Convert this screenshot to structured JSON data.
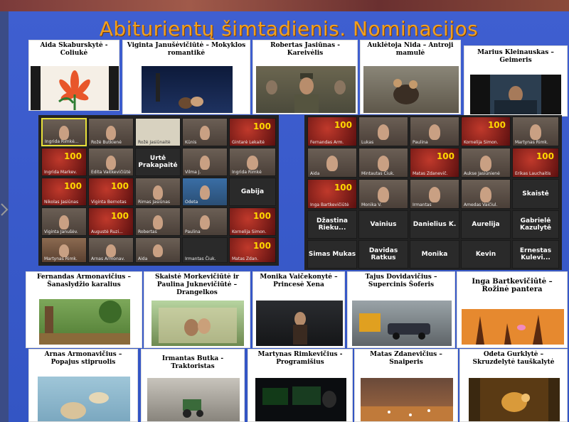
{
  "title": "Abiturientų šimtadienis. Nominacijos",
  "colors": {
    "title": "#f0a020",
    "slide": "#3f5fd0",
    "tile100": "#c0392b"
  },
  "top_cards": [
    {
      "label": "Aida Skaburskytė - Coliukė"
    },
    {
      "label": "Viginta Janušėvičiūtė – Mokyklos romantikė"
    },
    {
      "label": "Robertas Jasiūnas - Kareivėlis"
    },
    {
      "label": "Auklėtoja Nida – Antroji mamulė"
    },
    {
      "label": "Marius Kleinauskas – Geimeris"
    }
  ],
  "mid_cards": [
    {
      "label": "Fernandas Armonavičius – Šanaslydžio karalius"
    },
    {
      "label": "Skaistė Morkevičiūtė ir Paulina Juknevičiūtė – Drangelkos"
    },
    {
      "label": "Monika Vaičekonytė – Princesė Xena"
    },
    {
      "label": "Tajus Dovidavičius – Supercinis Šoferis"
    },
    {
      "label": "Inga Bartkevičiūtė – Rožinė pantera"
    }
  ],
  "bottom_cards": [
    {
      "label": "Arnas Armonavičius – Popajus stipruolis"
    },
    {
      "label": "Irmantas Butka - Traktoristas"
    },
    {
      "label": "Martynas Rimkevičius - Programišius"
    },
    {
      "label": "Matas Zdanevičius – Snaiperis"
    },
    {
      "label": "Odeta Gurklytė – Skruzdelytė tauškalytė"
    }
  ],
  "left_grid": {
    "named_tiles": [
      {
        "label": "Urtė Prakapaitė"
      },
      {
        "label": "Gabija"
      }
    ],
    "badge": "100"
  },
  "right_grid": {
    "named_tiles": [
      {
        "label": "Skaistė"
      },
      {
        "label": "Džastina Rieku..."
      },
      {
        "label": "Vainius"
      },
      {
        "label": "Danielius K."
      },
      {
        "label": "Aurelija"
      },
      {
        "label": "Gabrielė Kazulytė"
      },
      {
        "label": "Simas Mukas"
      },
      {
        "label": "Davidas Ratkus"
      },
      {
        "label": "Monika"
      },
      {
        "label": "Kevin"
      },
      {
        "label": "Ernestas Kulevi..."
      }
    ],
    "badge": "100"
  }
}
